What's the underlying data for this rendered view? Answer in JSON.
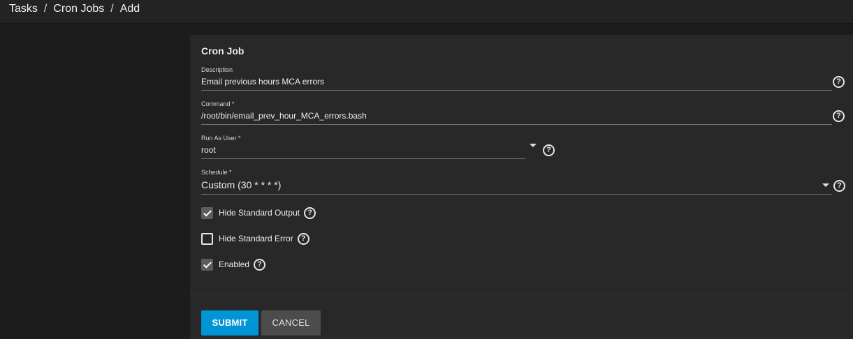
{
  "breadcrumb": {
    "items": [
      "Tasks",
      "Cron Jobs",
      "Add"
    ],
    "separator": "/"
  },
  "card": {
    "title": "Cron Job"
  },
  "fields": {
    "description": {
      "label": "Description",
      "value": "Email previous hours MCA errors"
    },
    "command": {
      "label": "Command *",
      "value": "/root/bin/email_prev_hour_MCA_errors.bash"
    },
    "run_as_user": {
      "label": "Run As User *",
      "value": "root"
    },
    "schedule": {
      "label": "Schedule *",
      "value": "Custom (30 * * * *)"
    }
  },
  "checkboxes": {
    "hide_stdout": {
      "label": "Hide Standard Output",
      "checked": true
    },
    "hide_stderr": {
      "label": "Hide Standard Error",
      "checked": false
    },
    "enabled": {
      "label": "Enabled",
      "checked": true
    }
  },
  "icons": {
    "help": "?"
  },
  "buttons": {
    "submit": "SUBMIT",
    "cancel": "CANCEL"
  },
  "colors": {
    "accent": "#0095d5",
    "background": "#1c1c1c",
    "card": "#282828"
  }
}
